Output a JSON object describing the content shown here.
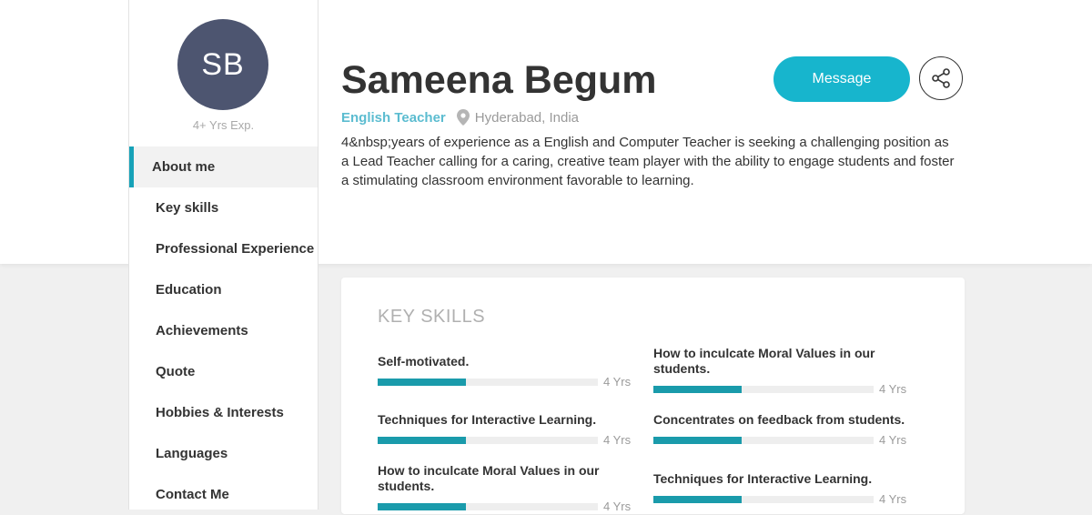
{
  "profile": {
    "initials": "SB",
    "experience": "4+ Yrs Exp.",
    "name": "Sameena Begum",
    "role": "English Teacher",
    "location": "Hyderabad, India",
    "about": "4&nbsp;years of experience as a English and Computer Teacher is seeking a challenging position as a Lead Teacher calling for a caring, creative team player with the ability to engage students and foster a stimulating classroom environment favorable to learning."
  },
  "actions": {
    "message_label": "Message",
    "share_icon": "share-icon"
  },
  "nav": {
    "items": [
      {
        "label": "About me",
        "active": true
      },
      {
        "label": "Key skills"
      },
      {
        "label": "Professional Experience"
      },
      {
        "label": "Education"
      },
      {
        "label": "Achievements"
      },
      {
        "label": "Quote"
      },
      {
        "label": "Hobbies & Interests"
      },
      {
        "label": "Languages"
      },
      {
        "label": "Contact Me"
      }
    ]
  },
  "key_skills": {
    "title": "KEY SKILLS",
    "items": [
      {
        "name": "Self-motivated.",
        "years": "4 Yrs",
        "level": 0.4
      },
      {
        "name": "How to inculcate Moral Values in our students.",
        "years": "4 Yrs",
        "level": 0.4
      },
      {
        "name": "Techniques for Interactive Learning.",
        "years": "4 Yrs",
        "level": 0.4
      },
      {
        "name": "Concentrates on feedback from students.",
        "years": "4 Yrs",
        "level": 0.4
      },
      {
        "name": "How to inculcate Moral Values in our students.",
        "years": "4 Yrs",
        "level": 0.4
      },
      {
        "name": "Techniques for Interactive Learning.",
        "years": "4 Yrs",
        "level": 0.4
      }
    ]
  },
  "colors": {
    "accent": "#17b5cd",
    "bar": "#1a9bab",
    "avatar": "#4d5570"
  }
}
